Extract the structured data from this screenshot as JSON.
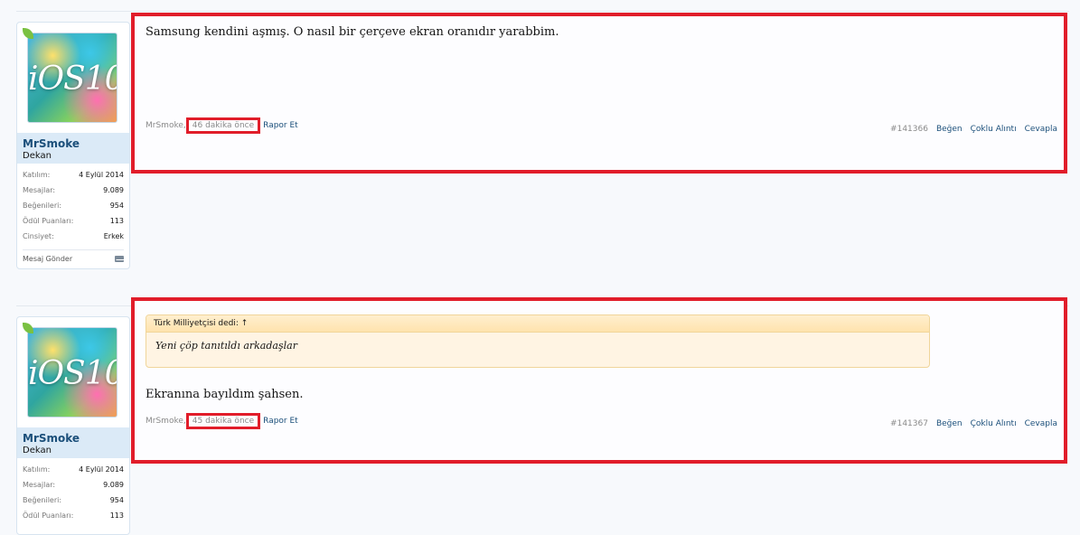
{
  "posts": [
    {
      "user": {
        "avatar_text": "iOS10",
        "name": "MrSmoke",
        "title": "Dekan",
        "stats": [
          {
            "label": "Katılım:",
            "value": "4 Eylül 2014"
          },
          {
            "label": "Mesajlar:",
            "value": "9.089"
          },
          {
            "label": "Beğenileri:",
            "value": "954"
          },
          {
            "label": "Ödül Puanları:",
            "value": "113"
          },
          {
            "label": "Cinsiyet:",
            "value": "Erkek"
          }
        ],
        "send_message": "Mesaj Gönder"
      },
      "message": "Samsung kendini aşmış. O nasıl bir çerçeve ekran oranıdır yarabbim.",
      "author": "MrSmoke,",
      "time": "46 dakika önce",
      "report": "Rapor Et",
      "post_number": "#141366",
      "actions": [
        "Beğen",
        "Çoklu Alıntı",
        "Cevapla"
      ]
    },
    {
      "user": {
        "avatar_text": "iOS10",
        "name": "MrSmoke",
        "title": "Dekan",
        "stats": [
          {
            "label": "Katılım:",
            "value": "4 Eylül 2014"
          },
          {
            "label": "Mesajlar:",
            "value": "9.089"
          },
          {
            "label": "Beğenileri:",
            "value": "954"
          },
          {
            "label": "Ödül Puanları:",
            "value": "113"
          }
        ]
      },
      "quote": {
        "header": "Türk Milliyetçisi dedi: ↑",
        "body": "Yeni çöp tanıtıldı arkadaşlar"
      },
      "message": "Ekranına bayıldım şahsen.",
      "author": "MrSmoke,",
      "time": "45 dakika önce",
      "report": "Rapor Et",
      "post_number": "#141367",
      "actions": [
        "Beğen",
        "Çoklu Alıntı",
        "Cevapla"
      ]
    }
  ],
  "colors": {
    "highlight_border": "#e11d2a",
    "username": "#1b4f7a",
    "link": "#1b4f7a",
    "quote_bg": "#fff4e3"
  }
}
